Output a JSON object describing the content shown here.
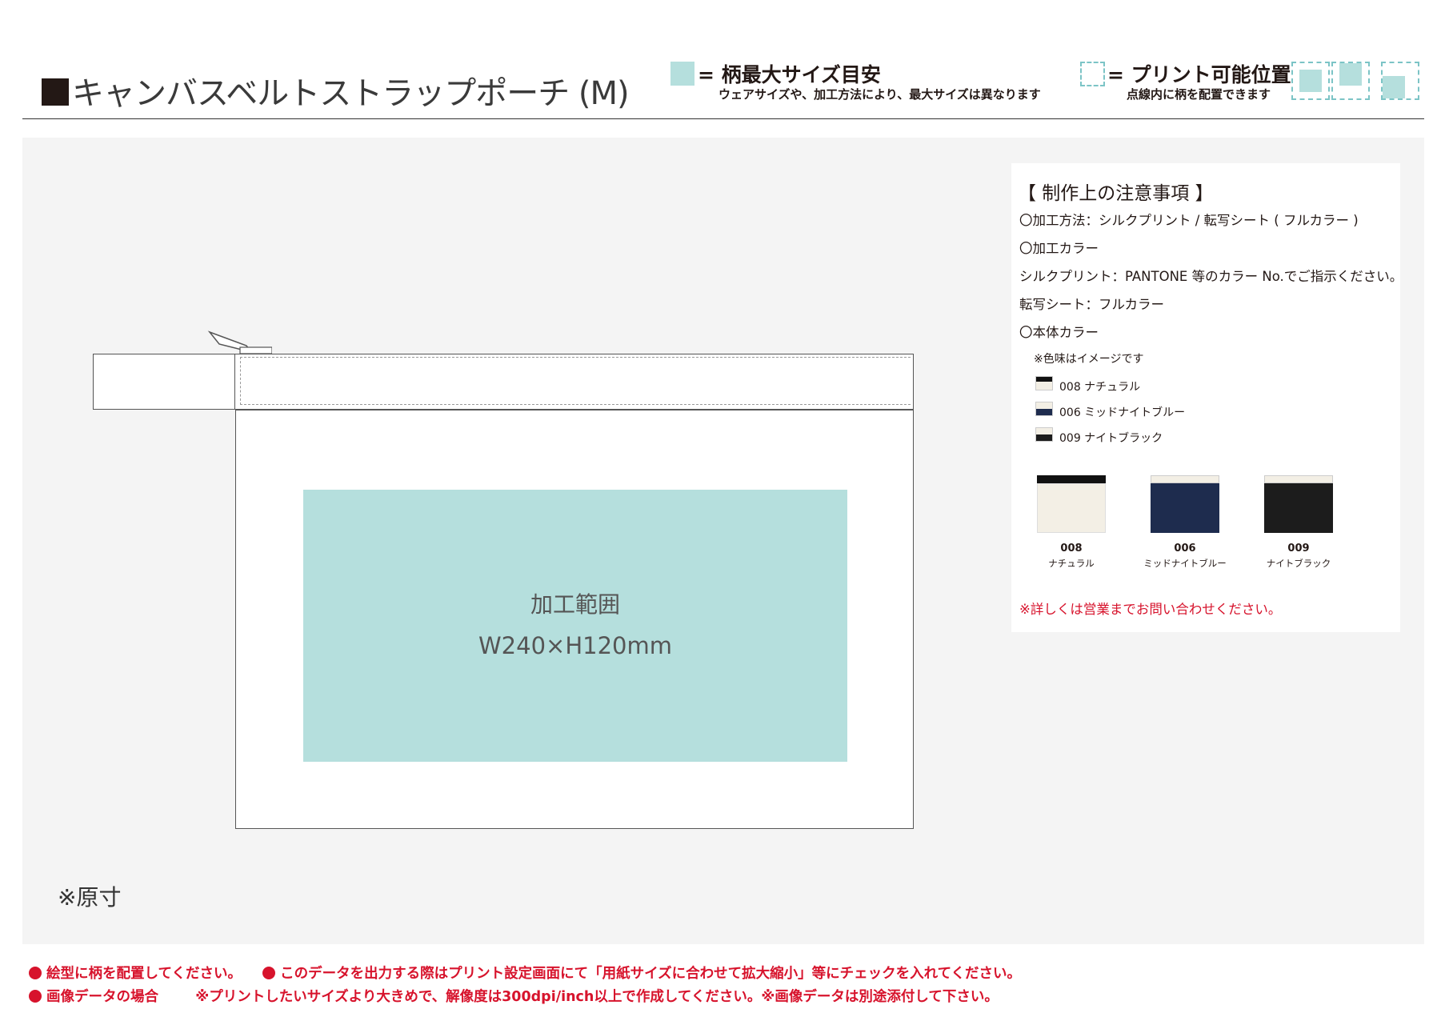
{
  "header": {
    "title": "キャンバスベルトストラップポーチ (M)",
    "legend_max": {
      "title": "= 柄最大サイズ目安",
      "sub": "ウェアサイズや、加工方法により、最大サイズは異なります"
    },
    "legend_print": {
      "title": "= プリント可能位置",
      "sub": "点線内に柄を配置できます"
    }
  },
  "canvas": {
    "print_area_label": "加工範囲",
    "print_area_size": "W240×H120mm",
    "scale_note": "※原寸"
  },
  "notes": {
    "heading": "【 制作上の注意事項 】",
    "method": "〇加工方法：シルクプリント / 転写シート ( フルカラー )",
    "color_heading": "〇加工カラー",
    "silk_color": "シルクプリント：PANTONE 等のカラー No.でご指示ください。",
    "transfer_color": "転写シート：フルカラー",
    "body_color_heading": "〇本体カラー",
    "body_color_note": "※色味はイメージです",
    "swatches": [
      {
        "label": "008 ナチュラル",
        "color": "#f3efe5"
      },
      {
        "label": "006 ミッドナイトブルー",
        "color": "#1e2c4e"
      },
      {
        "label": "009 ナイトブラック",
        "color": "#1c1c1c"
      }
    ],
    "products": [
      {
        "code": "008",
        "name": "ナチュラル"
      },
      {
        "code": "006",
        "name": "ミッドナイトブルー"
      },
      {
        "code": "009",
        "name": "ナイトブラック"
      }
    ],
    "contact": "※詳しくは営業までお問い合わせください。"
  },
  "footer": {
    "line1_a": "絵型に柄を配置してください。",
    "line1_b": "このデータを出力する際はプリント設定画面にて「用紙サイズに合わせて拡大縮小」等にチェックを入れてください。",
    "line2_a": "画像データの場合",
    "line2_b": "※プリントしたいサイズより大きめで、解像度は300dpi/inch以上で作成してください。※画像データは別途添付して下さい。"
  },
  "colors": {
    "print_area": "#b5dfdd",
    "accent_red": "#d7132c"
  }
}
